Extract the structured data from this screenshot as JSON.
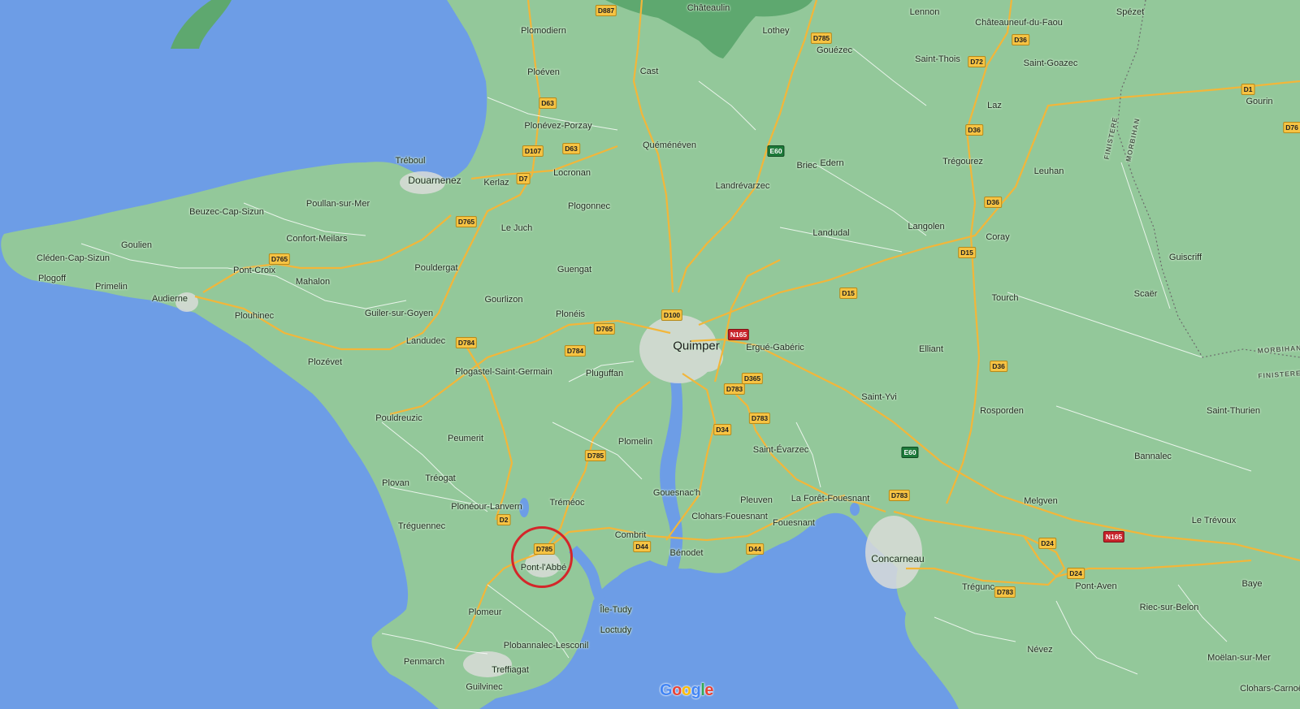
{
  "map": {
    "colors": {
      "sea": "#6d9de6",
      "land": "#93c89a",
      "forest": "#5ea86f",
      "roads": "#f2b63a",
      "urban": "#d9dcd8",
      "highlight": "#d4262a"
    },
    "places": {
      "chateaulin": "Châteaulin",
      "lennon": "Lennon",
      "spezet": "Spézet",
      "chateauneuf": "Châteauneuf-du-Faou",
      "plomodiern": "Plomodiern",
      "lothey": "Lothey",
      "gouezec": "Gouézec",
      "saint_thois": "Saint-Thois",
      "saint_goazec": "Saint-Goazec",
      "ploeven": "Ploéven",
      "cast": "Cast",
      "laz": "Laz",
      "gourin": "Gourin",
      "plonevez_porzay": "Plonévez-Porzay",
      "quemeneven": "Quéménéven",
      "treboul": "Tréboul",
      "douarnenez": "Douarnenez",
      "kerlaz": "Kerlaz",
      "locronan": "Locronan",
      "briec": "Briec",
      "edern": "Edern",
      "tregourez": "Trégourez",
      "leuhan": "Leuhan",
      "landrevarzec": "Landrévarzec",
      "poullan": "Poullan-sur-Mer",
      "beuzec": "Beuzec-Cap-Sizun",
      "plogonnec": "Plogonnec",
      "le_juch": "Le Juch",
      "langolen": "Langolen",
      "landudal": "Landudal",
      "coray": "Coray",
      "goulien": "Goulien",
      "confort": "Confort-Meilars",
      "cleden": "Cléden-Cap-Sizun",
      "guiscriff": "Guiscriff",
      "pont_croix": "Pont-Croix",
      "pouldergat": "Pouldergat",
      "guengat": "Guengat",
      "plogoff": "Plogoff",
      "mahalon": "Mahalon",
      "primelin": "Primelin",
      "scaer": "Scaër",
      "tourch": "Tourch",
      "gourlizon": "Gourlizon",
      "audierne": "Audierne",
      "plouhinec": "Plouhinec",
      "guiler": "Guiler-sur-Goyen",
      "ploneis": "Plonéis",
      "landudec": "Landudec",
      "quimper": "Quimper",
      "ergue": "Ergué-Gabéric",
      "elliant": "Elliant",
      "plozevet": "Plozévet",
      "plogastel": "Plogastel-Saint-Germain",
      "pluguffan": "Pluguffan",
      "saint_yvi": "Saint-Yvi",
      "rosporden": "Rosporden",
      "saint_thurien": "Saint-Thurien",
      "pouldreuzic": "Pouldreuzic",
      "peumerit": "Peumerit",
      "plomelin": "Plomelin",
      "saint_evarzec": "Saint-Évarzec",
      "bannalec": "Bannalec",
      "plovan": "Plovan",
      "treogat": "Tréogat",
      "gouesnach": "Gouesnac'h",
      "pleuven": "Pleuven",
      "la_foret": "La Forêt-Fouesnant",
      "melgven": "Melgven",
      "treguennec": "Tréguennec",
      "ploneour": "Plonéour-Lanvern",
      "tremeoc": "Tréméoc",
      "clohars_f": "Clohars-Fouesnant",
      "fouesnant": "Fouesnant",
      "le_trevoux": "Le Trévoux",
      "combrit": "Combrit",
      "pont_labbe": "Pont-l'Abbé",
      "benodet": "Bénodet",
      "concarneau": "Concarneau",
      "baye": "Baye",
      "pont_aven": "Pont-Aven",
      "tregunc": "Trégunc",
      "ile_tudy": "Île-Tudy",
      "plomeur": "Plomeur",
      "riec": "Riec-sur-Belon",
      "loctudy": "Loctudy",
      "plobannalec": "Plobannalec-Lesconil",
      "nevez": "Névez",
      "penmarch": "Penmarch",
      "moelan": "Moëlan-sur-Mer",
      "treffiagat": "Treffiagat",
      "guilvinec": "Guilvinec",
      "clohars_c": "Clohars-Carnoë",
      "finistere_v": "FINISTERE",
      "morbihan_v": "MORBIHAN",
      "morbihan_h": "MORBIHAN",
      "finistere_h": "FINISTERE"
    },
    "roads": {
      "d887": "D887",
      "d785a": "D785",
      "d36a": "D36",
      "d72": "D72",
      "d1": "D1",
      "d63a": "D63",
      "d36b": "D36",
      "d76": "D76",
      "d107": "D107",
      "d63b": "D63",
      "e60a": "E60",
      "d7": "D7",
      "d36c": "D36",
      "d765a": "D765",
      "d15a": "D15",
      "d765b": "D765",
      "d15b": "D15",
      "d100": "D100",
      "d765c": "D765",
      "n165a": "N165",
      "d784a": "D784",
      "d784b": "D784",
      "d365": "D365",
      "d36d": "D36",
      "d783a": "D783",
      "d783b": "D783",
      "d34": "D34",
      "d785b": "D785",
      "e60b": "E60",
      "d783c": "D783",
      "d2": "D2",
      "n165b": "N165",
      "d785c": "D785",
      "d44a": "D44",
      "d44b": "D44",
      "d24a": "D24",
      "d24b": "D24",
      "d783d": "D783"
    },
    "logo": {
      "letters": [
        "G",
        "o",
        "o",
        "g",
        "l",
        "e"
      ],
      "colors": [
        "#4285f4",
        "#ea4335",
        "#fbbc05",
        "#4285f4",
        "#34a853",
        "#ea4335"
      ]
    },
    "highlight": {
      "target": "Pont-l'Abbé"
    }
  }
}
